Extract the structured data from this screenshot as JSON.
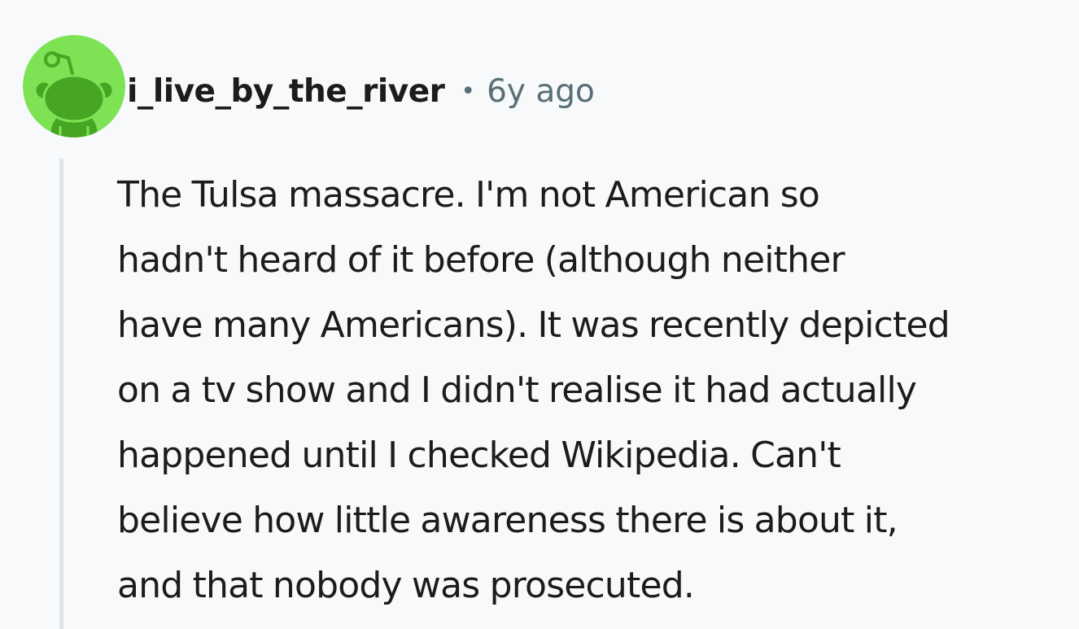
{
  "comment": {
    "author": {
      "username": "i_live_by_the_river",
      "avatar_icon": "snoo-avatar-icon",
      "avatar_bg_color": "#7ee255",
      "avatar_fg_color": "#46a523"
    },
    "separator": "•",
    "timestamp": "6y ago",
    "body_lines": [
      "The Tulsa massacre. I'm not American so",
      "hadn't heard of it before (although neither",
      "have many Americans). It was recently depicted",
      "on a tv show and I didn't realise it had actually",
      "happened until I checked Wikipedia. Can't",
      "believe how little awareness there is about it,",
      "and that nobody was prosecuted."
    ]
  }
}
